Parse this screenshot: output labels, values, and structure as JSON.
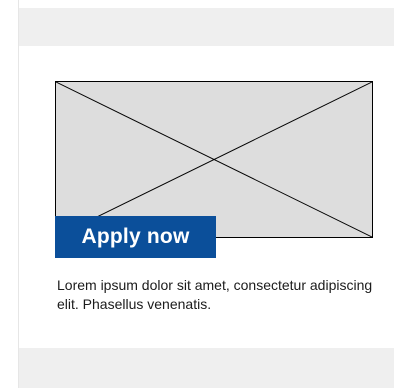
{
  "card": {
    "image": {
      "icon": "image-placeholder-icon"
    },
    "cta": {
      "label": "Apply now"
    },
    "description": "Lorem ipsum dolor sit amet, consectetur adipiscing elit. Phasellus venenatis."
  },
  "theme": {
    "cta_background": "#0b4f9a",
    "cta_text": "#ffffff",
    "band_background": "#efefef",
    "image_placeholder_fill": "#dddddd"
  }
}
